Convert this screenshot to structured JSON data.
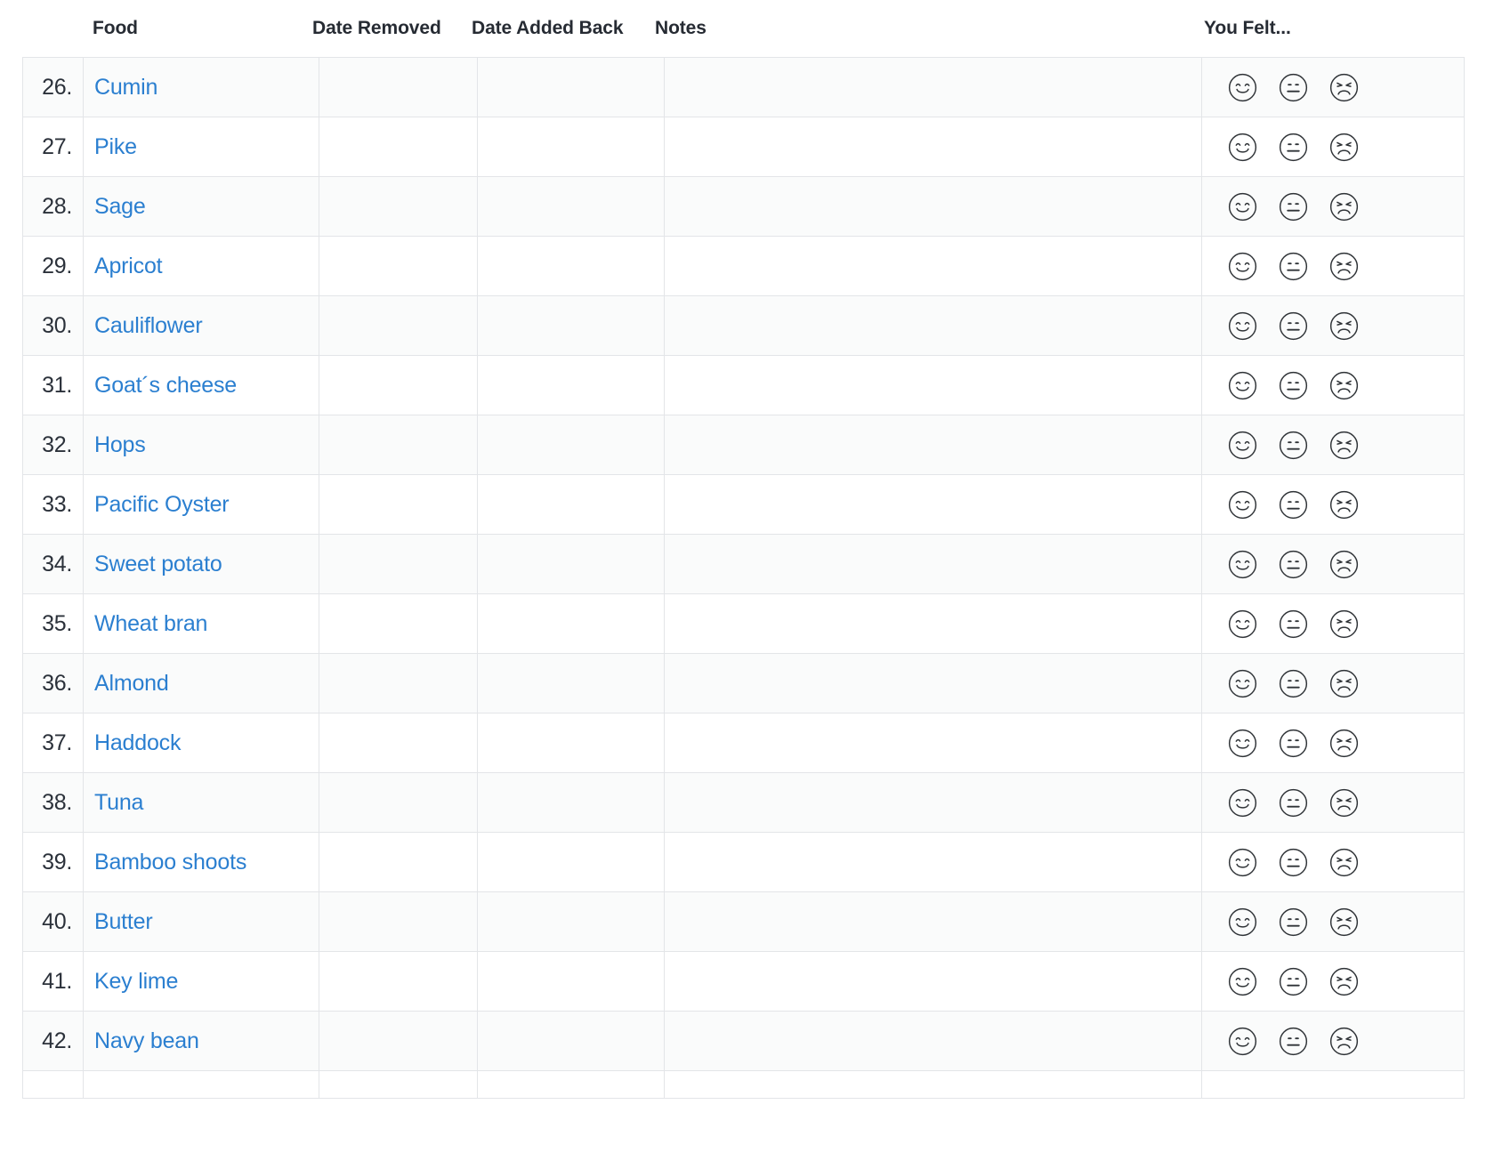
{
  "table": {
    "columns": [
      {
        "key": "num",
        "label": ""
      },
      {
        "key": "food",
        "label": "Food"
      },
      {
        "key": "removed",
        "label": "Date Removed"
      },
      {
        "key": "added",
        "label": "Date Added Back"
      },
      {
        "key": "notes",
        "label": "Notes"
      },
      {
        "key": "felt",
        "label": "You Felt..."
      }
    ],
    "rating_options": [
      {
        "name": "happy-face-icon",
        "label": "Happy"
      },
      {
        "name": "neutral-face-icon",
        "label": "Neutral"
      },
      {
        "name": "unhappy-face-icon",
        "label": "Unhappy"
      }
    ],
    "rows": [
      {
        "num": "26.",
        "food": "Cumin",
        "removed": "",
        "added": "",
        "notes": "",
        "felt": ""
      },
      {
        "num": "27.",
        "food": "Pike",
        "removed": "",
        "added": "",
        "notes": "",
        "felt": ""
      },
      {
        "num": "28.",
        "food": "Sage",
        "removed": "",
        "added": "",
        "notes": "",
        "felt": ""
      },
      {
        "num": "29.",
        "food": "Apricot",
        "removed": "",
        "added": "",
        "notes": "",
        "felt": ""
      },
      {
        "num": "30.",
        "food": "Cauliflower",
        "removed": "",
        "added": "",
        "notes": "",
        "felt": ""
      },
      {
        "num": "31.",
        "food": "Goat´s cheese",
        "removed": "",
        "added": "",
        "notes": "",
        "felt": ""
      },
      {
        "num": "32.",
        "food": "Hops",
        "removed": "",
        "added": "",
        "notes": "",
        "felt": ""
      },
      {
        "num": "33.",
        "food": "Pacific Oyster",
        "removed": "",
        "added": "",
        "notes": "",
        "felt": ""
      },
      {
        "num": "34.",
        "food": "Sweet potato",
        "removed": "",
        "added": "",
        "notes": "",
        "felt": ""
      },
      {
        "num": "35.",
        "food": "Wheat bran",
        "removed": "",
        "added": "",
        "notes": "",
        "felt": ""
      },
      {
        "num": "36.",
        "food": "Almond",
        "removed": "",
        "added": "",
        "notes": "",
        "felt": ""
      },
      {
        "num": "37.",
        "food": "Haddock",
        "removed": "",
        "added": "",
        "notes": "",
        "felt": ""
      },
      {
        "num": "38.",
        "food": "Tuna",
        "removed": "",
        "added": "",
        "notes": "",
        "felt": ""
      },
      {
        "num": "39.",
        "food": "Bamboo shoots",
        "removed": "",
        "added": "",
        "notes": "",
        "felt": ""
      },
      {
        "num": "40.",
        "food": "Butter",
        "removed": "",
        "added": "",
        "notes": "",
        "felt": ""
      },
      {
        "num": "41.",
        "food": "Key lime",
        "removed": "",
        "added": "",
        "notes": "",
        "felt": ""
      },
      {
        "num": "42.",
        "food": "Navy bean",
        "removed": "",
        "added": "",
        "notes": "",
        "felt": ""
      },
      {
        "num": "",
        "food": "",
        "removed": "",
        "added": "",
        "notes": "",
        "felt": ""
      }
    ]
  },
  "colors": {
    "link": "#2b7fd0",
    "text": "#2b313a",
    "header_text": "#262b33",
    "border": "#e3e5e8",
    "row_shade": "#fafbfb",
    "icon_stroke": "#2f3337"
  }
}
